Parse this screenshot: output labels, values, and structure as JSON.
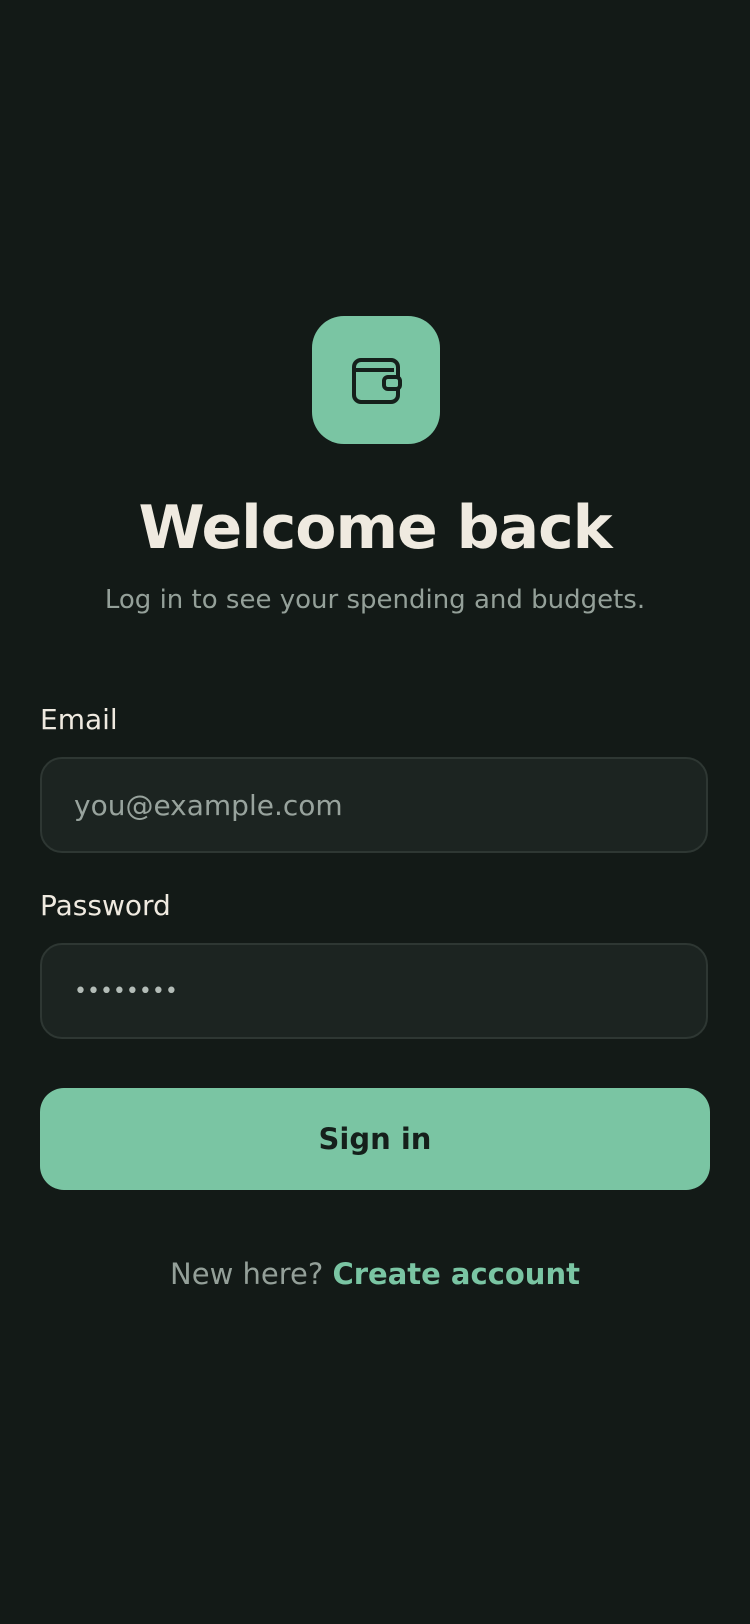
{
  "brand": {
    "icon": "wallet-icon",
    "accent_color": "#7ac5a3"
  },
  "header": {
    "title": "Welcome back",
    "subtitle": "Log in to see your spending and budgets."
  },
  "form": {
    "email_label": "Email",
    "email_placeholder": "you@example.com",
    "password_label": "Password",
    "password_value": "••••••••",
    "submit_label": "Sign in"
  },
  "footer": {
    "prompt": "New here?",
    "link_label": "Create account"
  }
}
